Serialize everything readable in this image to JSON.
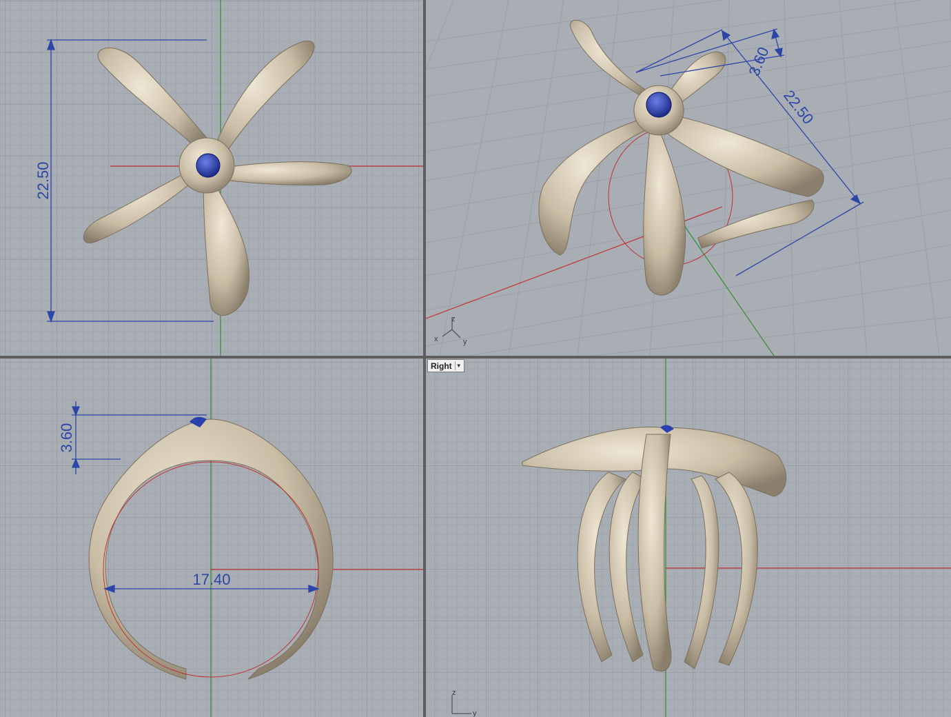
{
  "viewports": {
    "top": {
      "dimensions": {
        "height": "22.50"
      }
    },
    "perspective": {
      "dimensions": {
        "depth": "3.60",
        "length": "22.50"
      },
      "axes": {
        "x": "x",
        "y": "y",
        "z": "z"
      }
    },
    "front": {
      "dimensions": {
        "depth": "3.60",
        "inner_diameter": "17.40"
      }
    },
    "right": {
      "label": "Right",
      "axes": {
        "y": "y",
        "z": "z"
      }
    }
  },
  "colors": {
    "background": "#a9adb4",
    "grid_minor": "#9aa0a8",
    "grid_major": "#8a9098",
    "x_axis": "#c03030",
    "y_axis": "#2f8f2f",
    "dimension": "#2c46a8",
    "metal": "#c9bda6",
    "gem": "#2a3fb0"
  }
}
